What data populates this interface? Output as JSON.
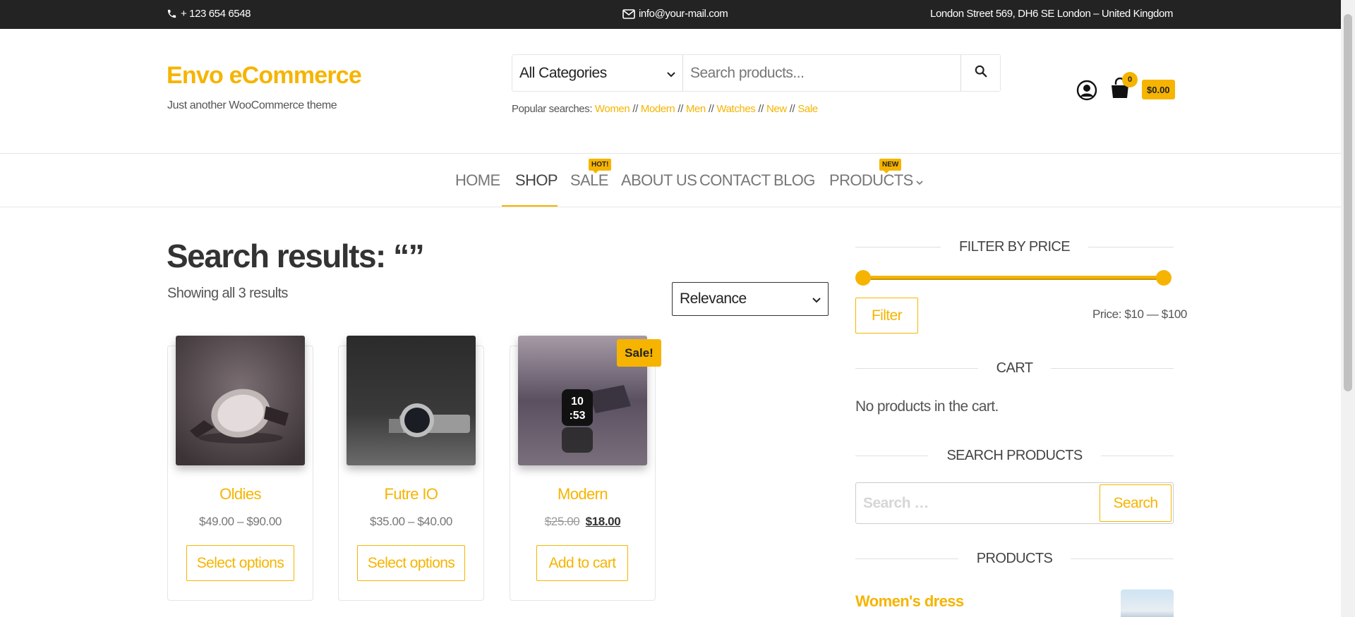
{
  "topbar": {
    "phone": "+ 123 654 6548",
    "email": "info@your-mail.com",
    "address": "London Street 569, DH6 SE London – United Kingdom"
  },
  "site": {
    "title": "Envo eCommerce",
    "tagline": "Just another WooCommerce theme"
  },
  "search": {
    "category": "All Categories",
    "placeholder": "Search products...",
    "popular_label": "Popular searches:",
    "popular": [
      "Women",
      "Modern",
      "Men",
      "Watches",
      "New",
      "Sale"
    ]
  },
  "cart": {
    "count": "0",
    "total": "$0.00"
  },
  "nav": {
    "items": [
      {
        "label": "HOME"
      },
      {
        "label": "SHOP"
      },
      {
        "label": "SALE",
        "badge": "HOT!"
      },
      {
        "label": "ABOUT US"
      },
      {
        "label": "CONTACT"
      },
      {
        "label": "BLOG"
      },
      {
        "label": "PRODUCTS",
        "badge": "NEW"
      }
    ],
    "active": "SHOP"
  },
  "main": {
    "title": "Search results: “”",
    "results_count": "Showing all 3 results",
    "orderby": "Relevance",
    "products": [
      {
        "name": "Oldies",
        "price": "$49.00 – $90.00",
        "button": "Select options"
      },
      {
        "name": "Futre IO",
        "price": "$35.00 – $40.00",
        "button": "Select options"
      },
      {
        "name": "Modern",
        "old_price": "$25.00",
        "new_price": "$18.00",
        "button": "Add to cart",
        "badge": "Sale!"
      }
    ]
  },
  "sidebar": {
    "filter_title": "FILTER BY PRICE",
    "filter_button": "Filter",
    "price_range": "Price: $10 — $100",
    "price_min_fraction": 0,
    "price_max_fraction": 1,
    "cart_title": "CART",
    "cart_empty": "No products in the cart.",
    "search_title": "SEARCH PRODUCTS",
    "search_placeholder": "Search …",
    "search_button": "Search",
    "products_title": "PRODUCTS",
    "first_product": "Women's dress"
  },
  "colors": {
    "accent": "#f6b400",
    "topbar": "#232323"
  }
}
